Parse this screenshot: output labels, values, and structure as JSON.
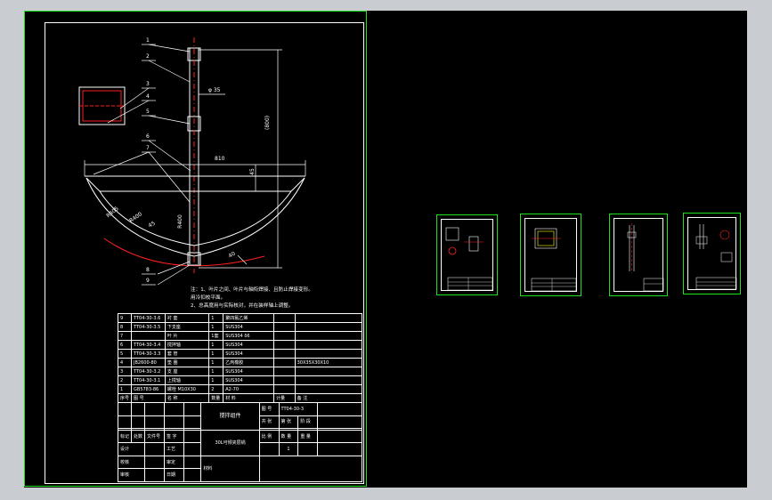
{
  "main_sheet": {
    "dim_diameter": "φ 35",
    "dim_width": "810",
    "dim_height": "(800)",
    "dim_small": "45",
    "dim_r1": "R405",
    "dim_r2": "R400",
    "dim_r3": "45",
    "dim_r4": "R400",
    "dim_bottom": "40",
    "leaders": [
      "1",
      "2",
      "3",
      "4",
      "5",
      "6",
      "7",
      "8",
      "9"
    ],
    "notes": [
      "注：1、叶片之间、叶片与轴衔焊接、且防止焊接变形。",
      "    用冷扣校平面。",
      "  2、总高度用与实际核对，并在装样轴上调整。"
    ],
    "bom_rows": [
      {
        "no": "9",
        "code": "TT04-30-3.6",
        "name": "衬 套",
        "qty": "1",
        "material": "聚四氟乙烯",
        "weight": "",
        "remark": ""
      },
      {
        "no": "8",
        "code": "TT04-30-3.5",
        "name": "下支座",
        "qty": "1",
        "material": "SUS304",
        "weight": "",
        "remark": ""
      },
      {
        "no": "7",
        "code": "",
        "name": "叶 片",
        "qty": "1套",
        "material": "SUS304 δ6",
        "weight": "",
        "remark": ""
      },
      {
        "no": "6",
        "code": "TT04-30-3.4",
        "name": "搅拌轴",
        "qty": "1",
        "material": "SUS304",
        "weight": "",
        "remark": ""
      },
      {
        "no": "5",
        "code": "TT04-30-3.3",
        "name": "套 管",
        "qty": "1",
        "material": "SUS304",
        "weight": "",
        "remark": ""
      },
      {
        "no": "4",
        "code": "JB2600-80",
        "name": "垫 圈",
        "qty": "1",
        "material": "乙丙橡胶",
        "weight": "",
        "remark": "30X35X30X10"
      },
      {
        "no": "3",
        "code": "TT04-30-3.2",
        "name": "支 座",
        "qty": "1",
        "material": "SUS304",
        "weight": "",
        "remark": ""
      },
      {
        "no": "2",
        "code": "TT04-30-3.1",
        "name": "上搅轴",
        "qty": "1",
        "material": "SUS304",
        "weight": "",
        "remark": ""
      },
      {
        "no": "1",
        "code": "GB5783-86",
        "name": "螺栓 M10X30",
        "qty": "2",
        "material": "A2-70",
        "weight": "",
        "remark": ""
      }
    ],
    "bom_header": {
      "no": "序号",
      "code": "图 号",
      "name": "名 称",
      "qty": "数量",
      "material": "材 料",
      "weight": "计量",
      "remark": "备 注"
    },
    "title_block": {
      "part_name": "搅拌组件",
      "drawing_no_label": "图 号",
      "drawing_no": "TT04-30-3",
      "sub_labels": [
        "共 张",
        "第 张",
        "阶 段"
      ],
      "mark_labels": [
        "标记",
        "处数",
        "文件号",
        "签 字"
      ],
      "project": "30L可倾夹层锅",
      "scale_label": "比 例",
      "qty_label": "数 量",
      "weight_label": "重 量",
      "qty_value": "1",
      "roles_left": [
        "设计",
        "校核",
        "审核"
      ],
      "roles_right": [
        "工艺",
        "审定",
        "日期"
      ],
      "material_label": "材料"
    }
  },
  "thumbnails": [
    {
      "name": "sheet-thumb-1"
    },
    {
      "name": "sheet-thumb-2"
    },
    {
      "name": "sheet-thumb-3"
    },
    {
      "name": "sheet-thumb-4"
    }
  ],
  "colors": {
    "background": "#000000",
    "line": "#ffffff",
    "red": "#ff2020",
    "green": "#1fe01f",
    "yellow": "#ffff00",
    "magenta": "#ff40ff"
  }
}
